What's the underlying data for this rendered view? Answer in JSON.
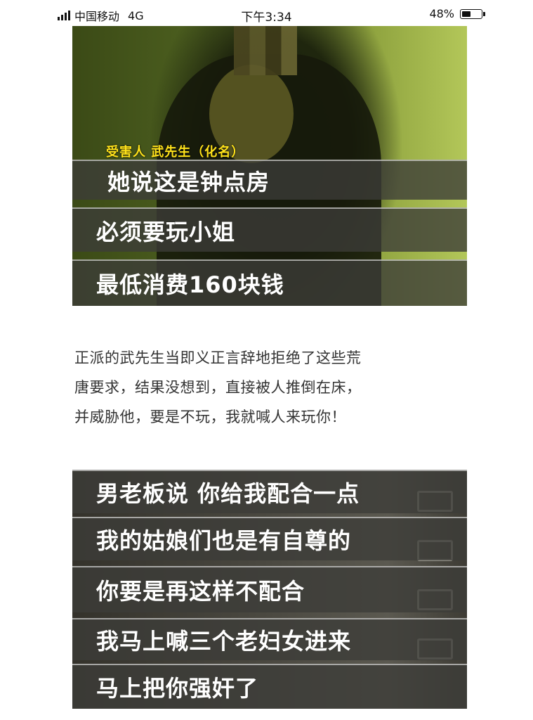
{
  "status_bar": {
    "carrier": "中国移动",
    "network": "4G",
    "time": "下午3:34",
    "battery": "48%",
    "battery_level": 0.48,
    "signal_icon": "signal-bars-icon",
    "battery_icon": "battery-icon"
  },
  "video_frame_1": {
    "victim_label": "受害人  武先生（化名）",
    "subtitles": [
      "她说这是钟点房",
      "必须要玩小姐",
      "最低消费160块钱"
    ]
  },
  "article": {
    "lines": [
      "正派的武先生当即义正言辞地拒绝了这些荒",
      "唐要求，结果没想到，直接被人推倒在床，",
      "并威胁他，要是不玩，我就喊人来玩你！"
    ]
  },
  "video_frame_2": {
    "subtitles": [
      "男老板说  你给我配合一点",
      "我的姑娘们也是有自尊的",
      "你要是再这样不配合",
      "我马上喊三个老妇女进来",
      "马上把你强奸了"
    ]
  }
}
